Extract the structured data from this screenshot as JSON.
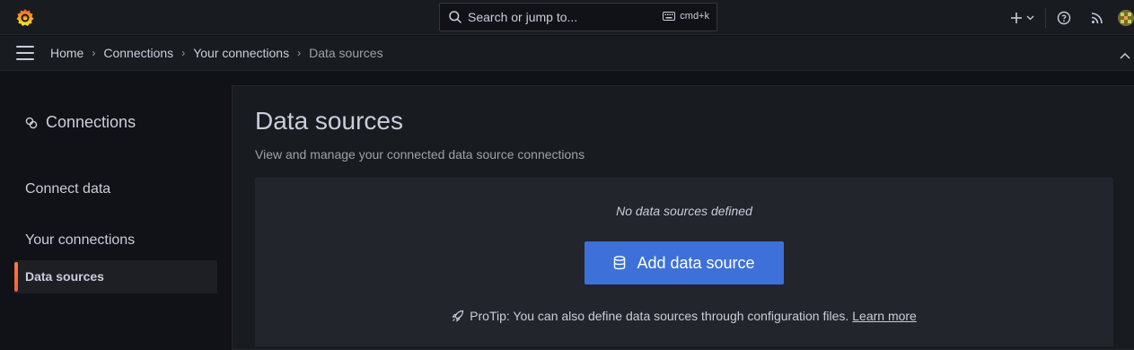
{
  "topbar": {
    "search_placeholder": "Search or jump to...",
    "shortcut": "cmd+k",
    "icons": [
      "grafana-logo",
      "plus-icon",
      "help-icon",
      "news-icon",
      "avatar"
    ]
  },
  "breadcrumbs": [
    "Home",
    "Connections",
    "Your connections",
    "Data sources"
  ],
  "sidebar": {
    "title": "Connections",
    "items": [
      {
        "label": "Connect data"
      },
      {
        "label": "Your connections"
      }
    ],
    "active_item": "Data sources"
  },
  "main": {
    "title": "Data sources",
    "subtitle": "View and manage your connected data source connections",
    "empty_message": "No data sources defined",
    "add_button_label": "Add data source",
    "protip_text": "ProTip: You can also define data sources through configuration files.",
    "protip_link": "Learn more"
  },
  "colors": {
    "accent": "#3d71d9",
    "active_bar": "#ff7941",
    "background": "#111217",
    "panel": "#181b1f"
  }
}
